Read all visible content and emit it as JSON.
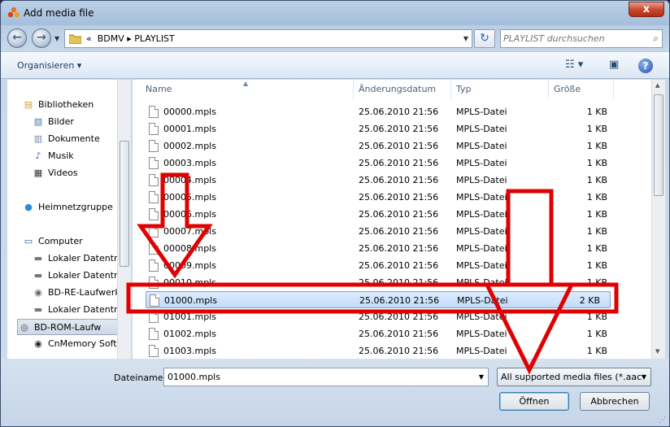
{
  "window": {
    "title": "Add media file",
    "close_label": "x"
  },
  "address": {
    "crumb_prefix": "«",
    "crumbs": "BDMV ▸ PLAYLIST"
  },
  "search": {
    "placeholder": "PLAYLIST durchsuchen"
  },
  "toolbar": {
    "organize_label": "Organisieren ▾"
  },
  "nav": {
    "items": [
      {
        "label": "Bibliotheken",
        "icon": "libraries-icon"
      },
      {
        "label": "Bilder",
        "icon": "pictures-icon"
      },
      {
        "label": "Dokumente",
        "icon": "documents-icon"
      },
      {
        "label": "Musik",
        "icon": "music-icon"
      },
      {
        "label": "Videos",
        "icon": "videos-icon"
      },
      {
        "label": "Heimnetzgruppe",
        "icon": "homegroup-icon"
      },
      {
        "label": "Computer",
        "icon": "computer-icon"
      },
      {
        "label": "Lokaler Datenträ",
        "icon": "drive-icon"
      },
      {
        "label": "Lokaler Datenträ",
        "icon": "drive-icon"
      },
      {
        "label": "BD-RE-Laufwerk",
        "icon": "disc-drive-icon"
      },
      {
        "label": "Lokaler Datenträ",
        "icon": "drive-icon"
      },
      {
        "label": "BD-ROM-Laufw",
        "icon": "bd-rom-icon"
      },
      {
        "label": "CnMemory Soft",
        "icon": "cd-icon"
      }
    ]
  },
  "columns": {
    "name": "Name",
    "date": "Änderungsdatum",
    "type": "Typ",
    "size": "Größe"
  },
  "files": [
    {
      "name": "00000.mpls",
      "date": "25.06.2010 21:56",
      "type": "MPLS-Datei",
      "size": "1 KB"
    },
    {
      "name": "00001.mpls",
      "date": "25.06.2010 21:56",
      "type": "MPLS-Datei",
      "size": "1 KB"
    },
    {
      "name": "00002.mpls",
      "date": "25.06.2010 21:56",
      "type": "MPLS-Datei",
      "size": "1 KB"
    },
    {
      "name": "00003.mpls",
      "date": "25.06.2010 21:56",
      "type": "MPLS-Datei",
      "size": "1 KB"
    },
    {
      "name": "00004.mpls",
      "date": "25.06.2010 21:56",
      "type": "MPLS-Datei",
      "size": "1 KB"
    },
    {
      "name": "00005.mpls",
      "date": "25.06.2010 21:56",
      "type": "MPLS-Datei",
      "size": "1 KB"
    },
    {
      "name": "00006.mpls",
      "date": "25.06.2010 21:56",
      "type": "MPLS-Datei",
      "size": "1 KB"
    },
    {
      "name": "00007.mpls",
      "date": "25.06.2010 21:56",
      "type": "MPLS-Datei",
      "size": "1 KB"
    },
    {
      "name": "00008.mpls",
      "date": "25.06.2010 21:56",
      "type": "MPLS-Datei",
      "size": "1 KB"
    },
    {
      "name": "00009.mpls",
      "date": "25.06.2010 21:56",
      "type": "MPLS-Datei",
      "size": "1 KB"
    },
    {
      "name": "00010.mpls",
      "date": "25.06.2010 21:56",
      "type": "MPLS-Datei",
      "size": "1 KB"
    },
    {
      "name": "01000.mpls",
      "date": "25.06.2010 21:56",
      "type": "MPLS-Datei",
      "size": "2 KB"
    },
    {
      "name": "01001.mpls",
      "date": "25.06.2010 21:56",
      "type": "MPLS-Datei",
      "size": "1 KB"
    },
    {
      "name": "01002.mpls",
      "date": "25.06.2010 21:56",
      "type": "MPLS-Datei",
      "size": "1 KB"
    },
    {
      "name": "01003.mpls",
      "date": "25.06.2010 21:56",
      "type": "MPLS-Datei",
      "size": "1 KB"
    }
  ],
  "selected_index": 11,
  "footer": {
    "filename_label": "Dateiname:",
    "filename_value": "01000.mpls",
    "filetype": "All supported media files (*.aac",
    "open_label": "Öffnen",
    "cancel_label": "Abbrechen"
  },
  "annotation_color": "#e00000"
}
